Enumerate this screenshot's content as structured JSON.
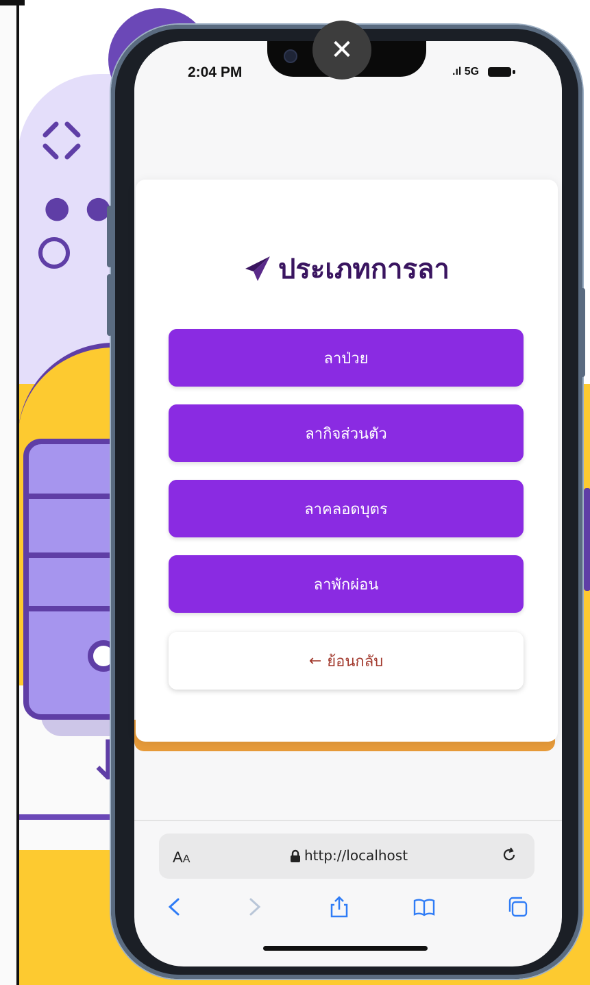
{
  "status": {
    "time": "2:04 PM",
    "signal": "5G"
  },
  "page": {
    "title": "ประเภทการลา",
    "buttons": [
      {
        "label": "ลาป่วย"
      },
      {
        "label": "ลากิจส่วนตัว"
      },
      {
        "label": "ลาคลอดบุตร"
      },
      {
        "label": "ลาพักผ่อน"
      }
    ],
    "back": {
      "arrow": "←",
      "label": "ย้อนกลับ"
    }
  },
  "browser": {
    "text_size_label": "A",
    "text_size_label_small": "A",
    "url": "http://localhost"
  },
  "colors": {
    "primary_button": "#8a2be2",
    "title": "#3a1560",
    "back_text": "#a23a2e",
    "accent_yellow": "#fdca30",
    "accent_purple": "#5f3ea6"
  },
  "icons": {
    "title": "paper-plane-icon",
    "close": "close-icon",
    "lock": "lock-icon",
    "reload": "reload-icon",
    "nav": [
      "back-chevron-icon",
      "forward-chevron-icon",
      "share-icon",
      "bookmarks-icon",
      "tabs-icon"
    ]
  }
}
